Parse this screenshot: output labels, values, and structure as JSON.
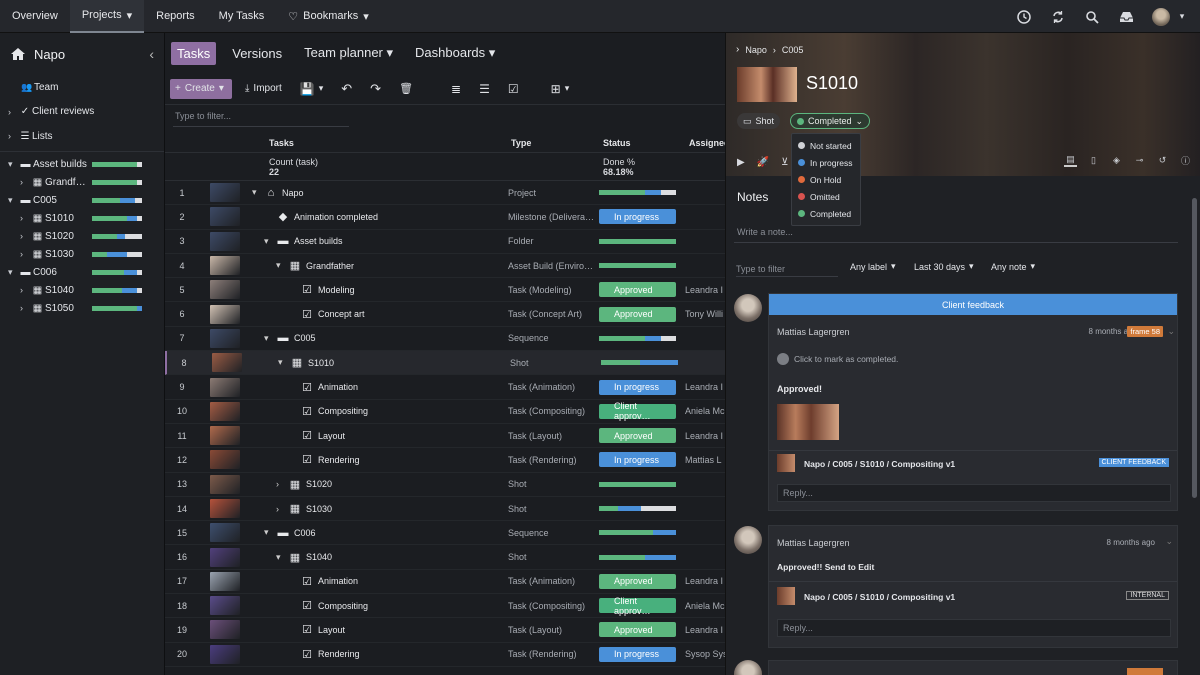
{
  "topnav": {
    "items": [
      "Overview",
      "Projects",
      "Reports",
      "My Tasks",
      "Bookmarks"
    ]
  },
  "sidebar": {
    "project": "Napo",
    "links": [
      "Team",
      "Client reviews",
      "Lists"
    ],
    "tree": [
      {
        "label": "Asset builds",
        "indent": 0
      },
      {
        "label": "Grandf…",
        "indent": 1
      },
      {
        "label": "C005",
        "indent": 0
      },
      {
        "label": "S1010",
        "indent": 1
      },
      {
        "label": "S1020",
        "indent": 1
      },
      {
        "label": "S1030",
        "indent": 1
      },
      {
        "label": "C006",
        "indent": 0
      },
      {
        "label": "S1040",
        "indent": 1
      },
      {
        "label": "S1050",
        "indent": 1
      }
    ]
  },
  "tabs": [
    "Tasks",
    "Versions",
    "Team planner",
    "Dashboards"
  ],
  "toolbar": {
    "create": "Create",
    "import": "Import",
    "filter_placeholder": "Type to filter..."
  },
  "table": {
    "headers": {
      "tasks": "Tasks",
      "type": "Type",
      "status": "Status",
      "assignee": "Assignee"
    },
    "count_label": "Count (task)",
    "count_value": "22",
    "done_label": "Done %",
    "done_value": "68.18%",
    "rows": [
      {
        "idx": "1",
        "name": "Napo",
        "type": "Project",
        "status": "bar",
        "icon": "home",
        "indent": 0,
        "toggle": "v",
        "assignee": ""
      },
      {
        "idx": "2",
        "name": "Animation completed",
        "type": "Milestone (Delivera…",
        "status": "In progress",
        "icon": "diamond",
        "indent": 1,
        "toggle": "",
        "assignee": ""
      },
      {
        "idx": "3",
        "name": "Asset builds",
        "type": "Folder",
        "status": "bar",
        "icon": "folder",
        "indent": 1,
        "toggle": "v",
        "assignee": ""
      },
      {
        "idx": "4",
        "name": "Grandfather",
        "type": "Asset Build (Enviro…",
        "status": "bar",
        "icon": "box",
        "indent": 2,
        "toggle": "v",
        "assignee": ""
      },
      {
        "idx": "5",
        "name": "Modeling",
        "type": "Task (Modeling)",
        "status": "Approved",
        "icon": "task",
        "indent": 3,
        "toggle": "",
        "assignee": "Leandra I"
      },
      {
        "idx": "6",
        "name": "Concept art",
        "type": "Task (Concept Art)",
        "status": "Approved",
        "icon": "task",
        "indent": 3,
        "toggle": "",
        "assignee": "Tony Willi"
      },
      {
        "idx": "7",
        "name": "C005",
        "type": "Sequence",
        "status": "bar",
        "icon": "folder",
        "indent": 1,
        "toggle": "v",
        "assignee": ""
      },
      {
        "idx": "8",
        "name": "S1010",
        "type": "Shot",
        "status": "bar",
        "icon": "clap",
        "indent": 2,
        "toggle": "v",
        "assignee": ""
      },
      {
        "idx": "9",
        "name": "Animation",
        "type": "Task (Animation)",
        "status": "In progress",
        "icon": "task",
        "indent": 3,
        "toggle": "",
        "assignee": "Leandra I"
      },
      {
        "idx": "10",
        "name": "Compositing",
        "type": "Task (Compositing)",
        "status": "Client approv…",
        "icon": "task",
        "indent": 3,
        "toggle": "",
        "assignee": "Aniela Mc"
      },
      {
        "idx": "11",
        "name": "Layout",
        "type": "Task (Layout)",
        "status": "Approved",
        "icon": "task",
        "indent": 3,
        "toggle": "",
        "assignee": "Leandra I"
      },
      {
        "idx": "12",
        "name": "Rendering",
        "type": "Task (Rendering)",
        "status": "In progress",
        "icon": "task",
        "indent": 3,
        "toggle": "",
        "assignee": "Mattias L"
      },
      {
        "idx": "13",
        "name": "S1020",
        "type": "Shot",
        "status": "bar",
        "icon": "clap",
        "indent": 2,
        "toggle": ">",
        "assignee": ""
      },
      {
        "idx": "14",
        "name": "S1030",
        "type": "Shot",
        "status": "bar",
        "icon": "clap",
        "indent": 2,
        "toggle": ">",
        "assignee": ""
      },
      {
        "idx": "15",
        "name": "C006",
        "type": "Sequence",
        "status": "bar",
        "icon": "folder",
        "indent": 1,
        "toggle": "v",
        "assignee": ""
      },
      {
        "idx": "16",
        "name": "S1040",
        "type": "Shot",
        "status": "bar",
        "icon": "clap",
        "indent": 2,
        "toggle": "v",
        "assignee": ""
      },
      {
        "idx": "17",
        "name": "Animation",
        "type": "Task (Animation)",
        "status": "Approved",
        "icon": "task",
        "indent": 3,
        "toggle": "",
        "assignee": "Leandra I"
      },
      {
        "idx": "18",
        "name": "Compositing",
        "type": "Task (Compositing)",
        "status": "Client approv…",
        "icon": "task",
        "indent": 3,
        "toggle": "",
        "assignee": "Aniela Mc"
      },
      {
        "idx": "19",
        "name": "Layout",
        "type": "Task (Layout)",
        "status": "Approved",
        "icon": "task",
        "indent": 3,
        "toggle": "",
        "assignee": "Leandra I"
      },
      {
        "idx": "20",
        "name": "Rendering",
        "type": "Task (Rendering)",
        "status": "In progress",
        "icon": "task",
        "indent": 3,
        "toggle": "",
        "assignee": "Sysop Sys"
      }
    ]
  },
  "status_colors": {
    "Approved": "#5cb67e",
    "In progress": "#4a90d9",
    "Client approv…": "#48b07d"
  },
  "panel": {
    "crumb_project": "Napo",
    "crumb_seq": "C005",
    "title": "S1010",
    "type_chip": "Shot",
    "status_chip": "Completed",
    "status_options": [
      {
        "label": "Not started",
        "color": "#d0d2d6"
      },
      {
        "label": "In progress",
        "color": "#4a90d9"
      },
      {
        "label": "On Hold",
        "color": "#e06a3c"
      },
      {
        "label": "Omitted",
        "color": "#d9534f"
      },
      {
        "label": "Completed",
        "color": "#5cb67e"
      }
    ],
    "notes_title": "Notes",
    "write_placeholder": "Write a note...",
    "filter_placeholder": "Type to filter",
    "filters": [
      "Any label",
      "Last 30 days",
      "Any note"
    ],
    "note1": {
      "header": "Client feedback",
      "author": "Mattias Lagergren",
      "time": "8 months ago",
      "frame": "frame 58",
      "complete": "Click to mark as completed.",
      "text": "Approved!",
      "version": "Napo / C005 / S1010 / Compositing v1",
      "tag": "CLIENT FEEDBACK",
      "reply": "Reply..."
    },
    "note2": {
      "author": "Mattias Lagergren",
      "time": "8 months ago",
      "text": "Approved!! Send to Edit",
      "version": "Napo / C005 / S1010 / Compositing v1",
      "tag": "INTERNAL",
      "reply": "Reply..."
    }
  }
}
